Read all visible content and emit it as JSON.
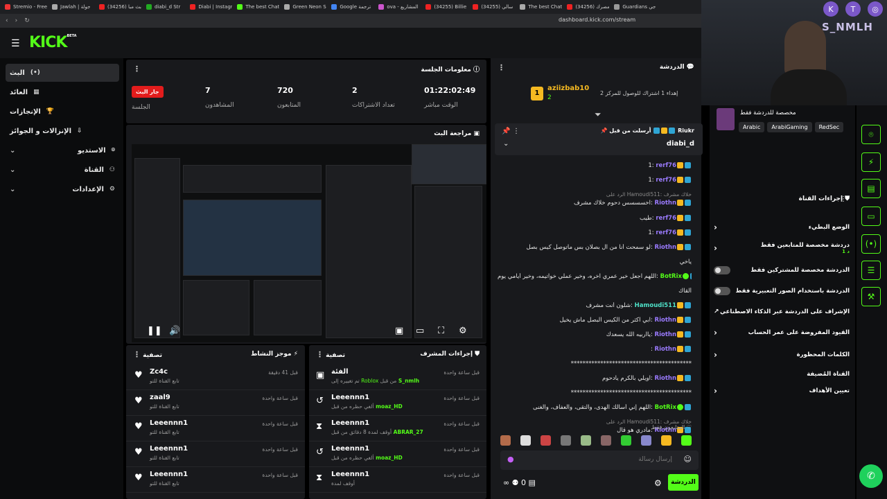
{
  "browser": {
    "tabs": [
      "Stremio - Free",
      "Jawlah | جولة",
      "(34256) بث مبا",
      "diabi_d Str",
      "Diabi | Instagr",
      "The best Chatb",
      "Green Neon Sc",
      "Google ترجمة",
      "ova - المشاريع",
      "(34255) Billie E",
      "(34255) سالي",
      "The best Chatb",
      "(34256) مصرك",
      "Guardians اجي"
    ],
    "url": "dashboard.kick.com/stream"
  },
  "header": {
    "logo": "KICK",
    "logo_sup": "BETA"
  },
  "sidebar": {
    "items": [
      {
        "label": "البث",
        "icon": "(•)"
      },
      {
        "label": "العائد",
        "icon": "▦"
      },
      {
        "label": "الإنجازات",
        "icon": "🏆"
      },
      {
        "label": "الإنزالات و الجوائز",
        "icon": "⇩"
      },
      {
        "label": "الاستديو",
        "icon": "⌾"
      },
      {
        "label": "القناة",
        "icon": "⚇"
      },
      {
        "label": "الإعدادات",
        "icon": "⚙"
      }
    ]
  },
  "session": {
    "title": "معلومات الجلسة",
    "live_badge": "جار البث",
    "session_label": "الجلسة",
    "stats": [
      {
        "value": "7",
        "label": "المشاهدون"
      },
      {
        "value": "720",
        "label": "المتابعون"
      },
      {
        "value": "2",
        "label": "تعداد الاشتراكات"
      },
      {
        "value": "01:22:02:49",
        "label": "الوقت مباشر"
      }
    ]
  },
  "preview": {
    "title": "مراجعة البث"
  },
  "activity": {
    "title": "موجز النشاط",
    "filter": "تصفية",
    "items": [
      {
        "name": "Zc4c",
        "sub": "تابع القناة للتو",
        "time": "قبل 41 دقيقة"
      },
      {
        "name": "zaal9",
        "sub": "تابع القناة للتو",
        "time": "قبل ساعة واحدة"
      },
      {
        "name": "Leeennn1",
        "sub": "تابع القناة للتو",
        "time": "قبل ساعة واحدة"
      },
      {
        "name": "Leeennn1",
        "sub": "تابع القناة للتو",
        "time": "قبل ساعة واحدة"
      },
      {
        "name": "Leeennn1",
        "sub": "تابع القناة للتو",
        "time": "قبل ساعة واحدة"
      }
    ]
  },
  "modactions": {
    "title": "إجراءات المشرف",
    "filter": "تصفية",
    "items": [
      {
        "name": "الفئة",
        "sub": "تم تغييره إلى",
        "hl": "Roblox",
        "sub2": "من قبل",
        "hl2": "S_nmlh",
        "time": "قبل ساعة واحدة",
        "icon": "▣"
      },
      {
        "name": "Leeennn1",
        "sub": "ألغي حظره من قبل",
        "hl2": "moaz_HD",
        "time": "قبل ساعة واحدة",
        "icon": "↺"
      },
      {
        "name": "Leeennn1",
        "sub": "أوقف لمدة 8 دقائق من قبل",
        "hl2": "ABRAR_27",
        "time": "قبل ساعة واحدة",
        "icon": "⧗"
      },
      {
        "name": "Leeennn1",
        "sub": "ألغي حظره من قبل",
        "hl2": "moaz_HD",
        "time": "قبل ساعة واحدة",
        "icon": "↺"
      },
      {
        "name": "Leeennn1",
        "sub": "أوقف لمدة",
        "hl2": "",
        "time": "قبل ساعة واحدة",
        "icon": "⧗"
      }
    ]
  },
  "chat": {
    "title": "الدردشة",
    "top_user": "aziizbab10",
    "top_rank": "1",
    "top_count": "2",
    "top_text": "إهداء 1 اشتراك للوصول للمركز 2",
    "pinned_by": "أرسلت من قبل",
    "pinned_user": "Riukr",
    "pinned_msg": "diabi_d",
    "messages": [
      {
        "user": "rerf76",
        "text": "1",
        "color": "#9b7bff"
      },
      {
        "user": "rerf76",
        "text": "1",
        "color": "#9b7bff"
      },
      {
        "reply": "الرد على Hamoudi511: خلاك مشرف",
        "user": "Riothn",
        "text": "اخسسسس دحوم خلاك مشرف",
        "color": "#9b7bff"
      },
      {
        "user": "rerf76",
        "text": "طيب",
        "color": "#9b7bff"
      },
      {
        "user": "rerf76",
        "text": "1",
        "color": "#9b7bff"
      },
      {
        "user": "Riothn",
        "text": "لو سمحت أنا من ال بصلان بس ماتوصل كيس بصل",
        "color": "#9b7bff"
      },
      {
        "user": "",
        "text": "ياخي",
        "color": "#9b7bff"
      },
      {
        "user": "BotRix",
        "text": "اللهم اجعل خير عمري آخره، وخير عملي خواتيمه، وخير أيامي يوم",
        "color": "#53fc18"
      },
      {
        "user": "",
        "text": "ألقاك",
        "color": "#53fc18"
      },
      {
        "user": "Hamoudi511",
        "text": "شلون أنت مشرف",
        "color": "#4ee0c7"
      },
      {
        "user": "Riothn",
        "text": "ابي اكثر من الكيس البصل ماش يخيل",
        "color": "#9b7bff"
      },
      {
        "user": "Riothn",
        "text": "يااربيه الله يسعدك",
        "color": "#9b7bff"
      },
      {
        "user": "Riothn",
        "text": "",
        "color": "#9b7bff"
      },
      {
        "user": "",
        "text": "*****************************************",
        "color": "#9b7bff"
      },
      {
        "user": "Riothn",
        "text": "اويلي بالكرم يادحوم",
        "color": "#9b7bff"
      },
      {
        "user": "",
        "text": "*****************************************",
        "color": "#9b7bff"
      },
      {
        "user": "BotRix",
        "text": "اللهم إني أسألك الهدى، والتقى، والعفاف، والغنى",
        "color": "#53fc18"
      },
      {
        "reply": "الرد على Hamoudi511: خلاك مشرف",
        "user": "Riothn",
        "text": "مادري هو قال",
        "color": "#9b7bff"
      }
    ],
    "followers_only": "المتابعون فقط",
    "input_placeholder": "إرسال رسالة",
    "send_label": "الدردشة",
    "viewer_count": "0"
  },
  "rightpanel": {
    "dedicated": "مخصصة للدردشة فقط",
    "tags": [
      "Arabic",
      "ArabiGaming",
      "RedSec"
    ],
    "channel_actions": "إجراءات القناة",
    "items": [
      {
        "label": "الوضع البطيء",
        "type": "arrow"
      },
      {
        "label": "دردشة مخصصة للمتابعين فقط",
        "sub": "1 د",
        "type": "arrow"
      },
      {
        "label": "الدردشة مخصصة للمشتركين فقط",
        "type": "toggle"
      },
      {
        "label": "الدردشة باستخدام الصور التعبيرية فقط",
        "type": "toggle"
      },
      {
        "label": "الإشراف على الدردشة عبر الذكاء الاصطناعي",
        "type": "ext"
      },
      {
        "label": "القيود المفروضة على عمر الحساب",
        "type": "arrow"
      },
      {
        "label": "الكلمات المحظورة",
        "type": "arrow"
      },
      {
        "label": "القناة المُضيفة",
        "type": "none"
      },
      {
        "label": "تعيين الأهداف",
        "type": "arrow"
      }
    ]
  },
  "webcam": {
    "name": "S_NMLH"
  },
  "colors": {
    "accent": "#53fc18",
    "live": "#e21c1c",
    "bg": "#18191c"
  }
}
